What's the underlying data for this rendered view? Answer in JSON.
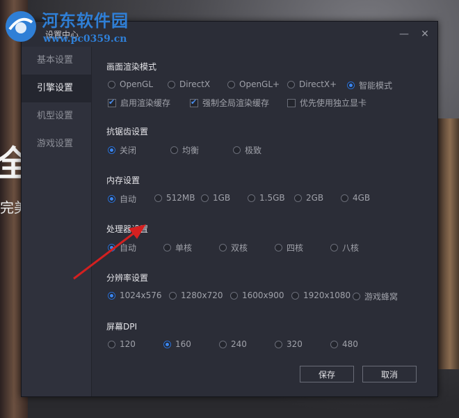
{
  "background": {
    "big_text": "全",
    "small_text": "完美"
  },
  "watermark": {
    "title": "河东软件园",
    "url": "www.pc0359.cn"
  },
  "dialog": {
    "title": "设置中心",
    "minimize_glyph": "—",
    "close_glyph": "✕"
  },
  "sidebar": {
    "items": [
      {
        "label": "基本设置",
        "active": false
      },
      {
        "label": "引擎设置",
        "active": true
      },
      {
        "label": "机型设置",
        "active": false
      },
      {
        "label": "游戏设置",
        "active": false
      }
    ]
  },
  "render": {
    "title": "画面渲染模式",
    "options": [
      "OpenGL",
      "DirectX",
      "OpenGL+",
      "DirectX+",
      "智能模式"
    ],
    "selected": "智能模式",
    "checkboxes": [
      {
        "label": "启用渲染缓存",
        "checked": true
      },
      {
        "label": "强制全局渲染缓存",
        "checked": true
      },
      {
        "label": "优先使用独立显卡",
        "checked": false
      }
    ]
  },
  "antialias": {
    "title": "抗锯齿设置",
    "options": [
      "关闭",
      "均衡",
      "极致"
    ],
    "selected": "关闭"
  },
  "memory": {
    "title": "内存设置",
    "options": [
      "自动",
      "512MB",
      "1GB",
      "1.5GB",
      "2GB",
      "4GB"
    ],
    "selected": "自动"
  },
  "cpu": {
    "title": "处理器设置",
    "options": [
      "自动",
      "单核",
      "双核",
      "四核",
      "八核"
    ],
    "selected": "自动"
  },
  "resolution": {
    "title": "分辨率设置",
    "options": [
      "1024x576",
      "1280x720",
      "1600x900",
      "1920x1080",
      "游戏蜂窝"
    ],
    "selected": "1024x576"
  },
  "dpi": {
    "title": "屏幕DPI",
    "options": [
      "120",
      "160",
      "240",
      "320",
      "480"
    ],
    "selected": "160"
  },
  "buttons": {
    "save": "保存",
    "cancel": "取消"
  },
  "colors": {
    "accent": "#3b86f0",
    "annotation_arrow": "#d42020",
    "watermark": "#2f7fd6"
  }
}
